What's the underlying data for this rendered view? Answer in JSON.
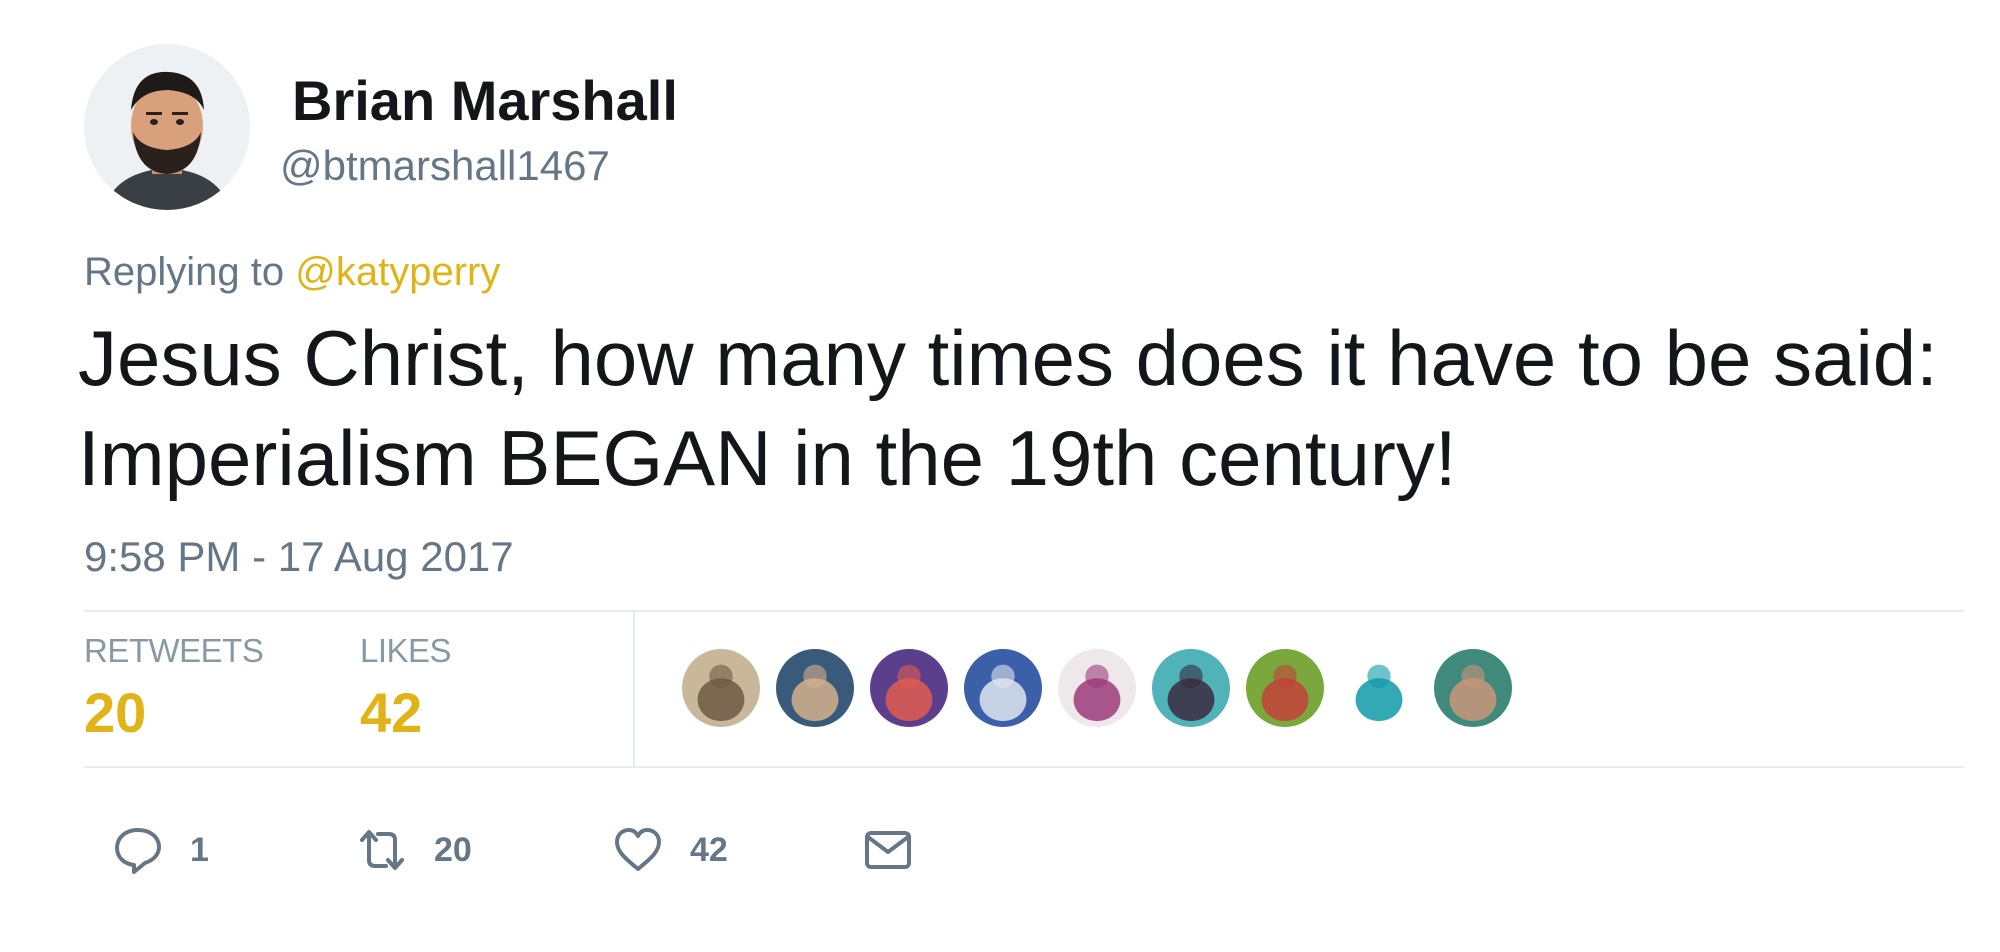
{
  "author": {
    "display_name": "Brian Marshall",
    "handle": "@btmarshall1467"
  },
  "reply": {
    "prefix": "Replying to",
    "mention": "@katyperry"
  },
  "tweet": {
    "text": "Jesus Christ, how many times does it have to be said: Imperialism BEGAN in the 19th century!",
    "timestamp": "9:58 PM - 17 Aug 2017"
  },
  "stats": {
    "retweets_label": "RETWEETS",
    "retweets_value": "20",
    "likes_label": "LIKES",
    "likes_value": "42"
  },
  "likers": [
    {
      "name": "liker-avatar-1",
      "color_a": "#c9b79a",
      "color_b": "#6e5a44"
    },
    {
      "name": "liker-avatar-2",
      "color_a": "#3a5a7c",
      "color_b": "#d4b08c"
    },
    {
      "name": "liker-avatar-3",
      "color_a": "#5b3f8c",
      "color_b": "#e05c4f"
    },
    {
      "name": "liker-avatar-4",
      "color_a": "#3b5fa8",
      "color_b": "#dfe6ef"
    },
    {
      "name": "liker-avatar-5",
      "color_a": "#efe8ea",
      "color_b": "#9b3b7a"
    },
    {
      "name": "liker-avatar-6",
      "color_a": "#4fb3b8",
      "color_b": "#3b2a3f"
    },
    {
      "name": "liker-avatar-7",
      "color_a": "#7aa83c",
      "color_b": "#c2423a"
    },
    {
      "name": "liker-avatar-8",
      "color_a": "#ffffff",
      "color_b": "#0f9aa8"
    },
    {
      "name": "liker-avatar-9",
      "color_a": "#3f8a7a",
      "color_b": "#c9957a"
    }
  ],
  "actions": {
    "reply_count": "1",
    "retweet_count": "20",
    "like_count": "42"
  },
  "colors": {
    "accent": "#e0b419",
    "muted": "#657786",
    "text": "#14171a"
  }
}
